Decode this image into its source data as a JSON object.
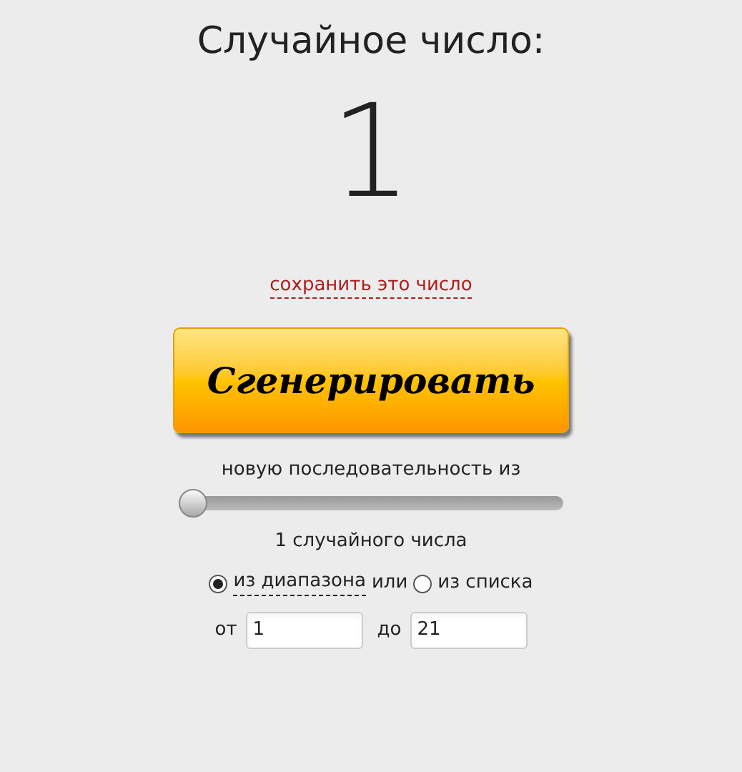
{
  "title": "Случайное число:",
  "number": "1",
  "save_link": "сохранить это число",
  "generate_button": "Сгенерировать",
  "sequence_label": "новую последовательность из",
  "count_slider": {
    "level": 0
  },
  "count_text": "1 случайного числа",
  "source_options": [
    {
      "label": "из диапазона",
      "selected": true
    },
    {
      "label": "из списка",
      "selected": false
    }
  ],
  "or_text": "или",
  "range": {
    "from_label": "от",
    "from_value": "1",
    "to_label": "до",
    "to_value": "21"
  }
}
